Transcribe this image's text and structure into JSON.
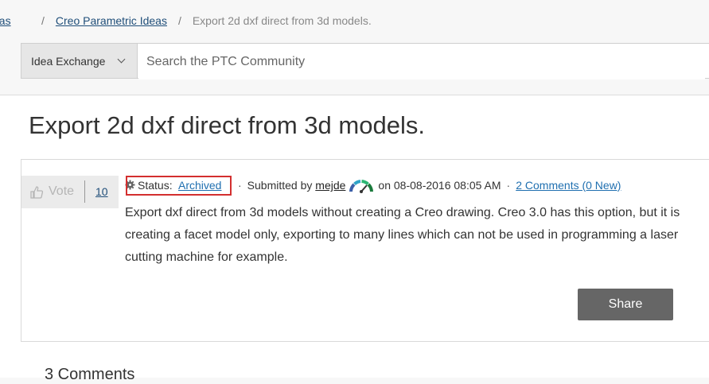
{
  "breadcrumb": {
    "first": "eas",
    "second": "Creo Parametric Ideas",
    "current": "Export 2d dxf direct from 3d models.",
    "separator": "/"
  },
  "search": {
    "scope": "Idea Exchange",
    "placeholder": "Search the PTC Community"
  },
  "idea": {
    "title": "Export 2d dxf direct from 3d models.",
    "vote_label": "Vote",
    "vote_count": "10",
    "status_label": "Status:",
    "status_value": "Archived",
    "submitted_by_label": "Submitted by",
    "author": "mejde",
    "date_text": "on 08-08-2016 08:05 AM",
    "comments_link": "2 Comments (0 New)",
    "description": "Export  dxf direct from 3d models without creating a Creo drawing. Creo 3.0 has this option, but it is creating a facet model only, exporting to many lines which can not be used in programming a laser cutting machine for example.",
    "share_label": "Share"
  },
  "comments_section": {
    "heading": "3 Comments"
  },
  "colors": {
    "link": "#1f4e79",
    "status_highlight": "#d32f2f",
    "share_button": "#666666"
  },
  "icons": {
    "vote": "thumbs-up-icon",
    "status": "gear-icon",
    "rank": "rank-gauge-icon",
    "scope": "chevron-down-icon"
  }
}
